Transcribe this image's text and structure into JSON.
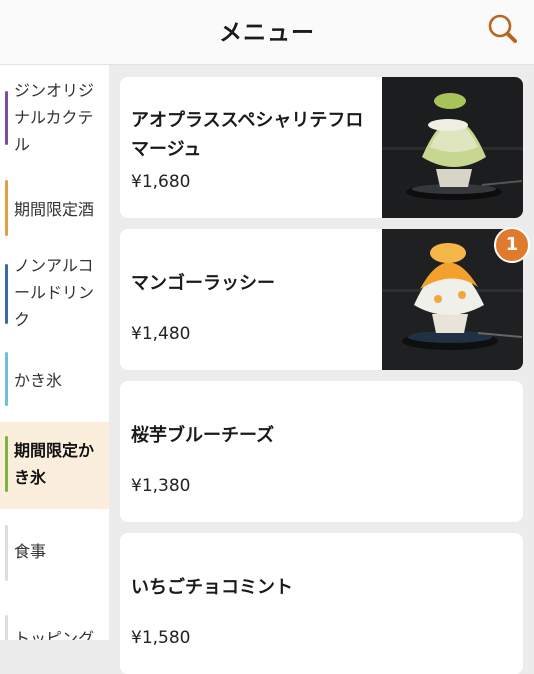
{
  "header": {
    "title": "メニュー"
  },
  "sidebar": {
    "items": [
      {
        "label": "ジンオリジナルカクテル",
        "color": "#7b4ea3"
      },
      {
        "label": "期間限定酒",
        "color": "#e0a040"
      },
      {
        "label": "ノンアルコールドリンク",
        "color": "#3a6aa8"
      },
      {
        "label": "かき氷",
        "color": "#6dc0d8"
      },
      {
        "label": "期間限定かき氷",
        "color": "#7cb342",
        "active": true
      },
      {
        "label": "食事",
        "color": "#dddddd"
      },
      {
        "label": "トッピング",
        "color": "#dddddd"
      }
    ]
  },
  "menu": {
    "items": [
      {
        "name": "アオプラススペシャリテフロマージュ",
        "price": "¥1,680",
        "image": "matcha-shaved-ice-photo"
      },
      {
        "name": "マンゴーラッシー",
        "price": "¥1,480",
        "image": "mango-shaved-ice-photo",
        "badge": "1"
      },
      {
        "name": "桜芋ブルーチーズ",
        "price": "¥1,380"
      },
      {
        "name": "いちごチョコミント",
        "price": "¥1,580"
      }
    ]
  }
}
